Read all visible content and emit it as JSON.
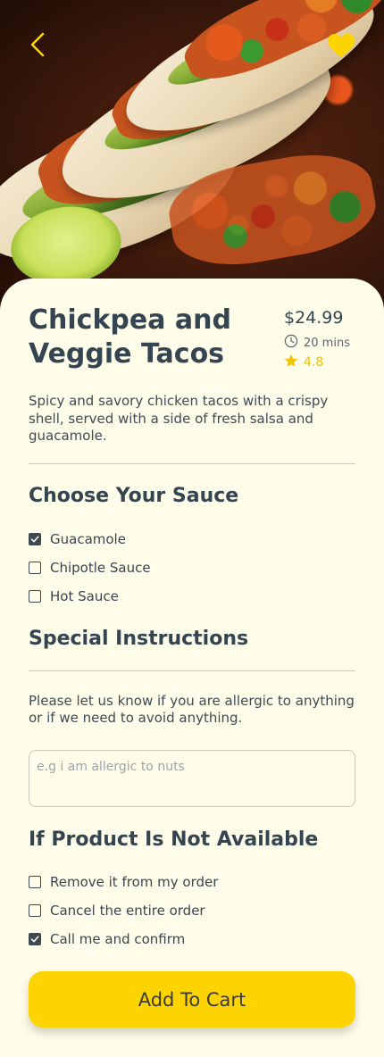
{
  "colors": {
    "accent": "#FDD300",
    "text": "#354451",
    "background": "#FEFDE9",
    "star": "#F2C300"
  },
  "header": {
    "back_icon": "chevron-left-icon",
    "favorite_icon": "heart-icon"
  },
  "product": {
    "title": "Chickpea and Veggie Tacos",
    "price": "$24.99",
    "time": "20 mins",
    "rating": "4.8",
    "description": "Spicy and savory chicken tacos with a crispy shell, served with a side of fresh salsa and guacamole."
  },
  "sauce": {
    "title": "Choose Your Sauce",
    "options": [
      {
        "label": "Guacamole",
        "checked": true
      },
      {
        "label": "Chipotle Sauce",
        "checked": false
      },
      {
        "label": "Hot Sauce",
        "checked": false
      }
    ]
  },
  "instructions": {
    "title": "Special Instructions",
    "text": "Please let us know if you are allergic to anything or if we need to avoid anything.",
    "placeholder": "e.g i am allergic to nuts",
    "value": ""
  },
  "unavailable": {
    "title": "If Product Is Not Available",
    "options": [
      {
        "label": "Remove it from my order",
        "checked": false
      },
      {
        "label": "Cancel the entire order",
        "checked": false
      },
      {
        "label": "Call me and confirm",
        "checked": true
      }
    ]
  },
  "cart": {
    "label": "Add To Cart"
  }
}
